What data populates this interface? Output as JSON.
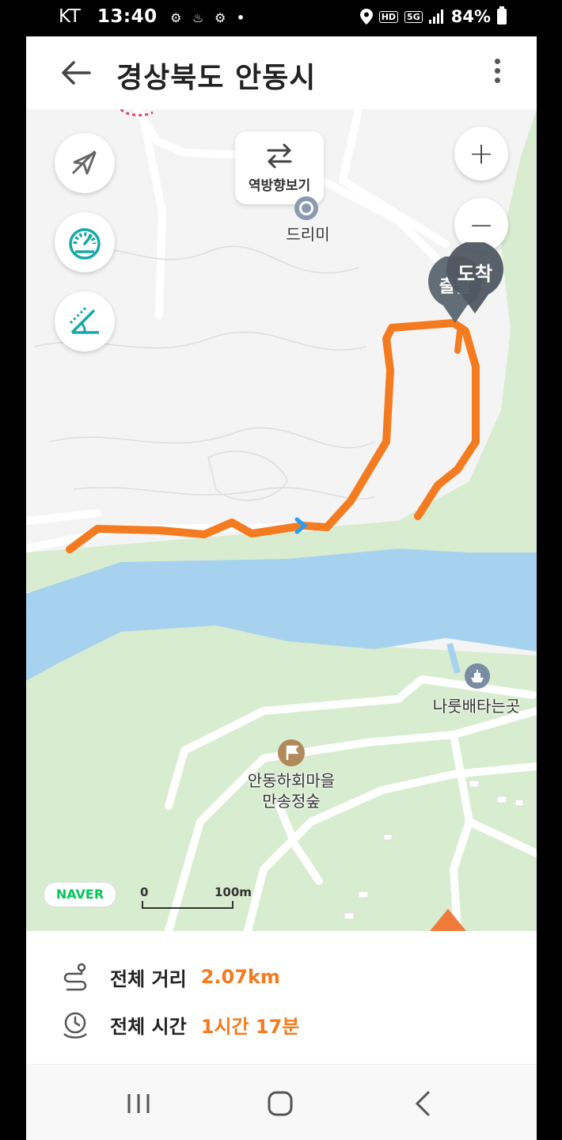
{
  "status_bar": {
    "carrier": "KT",
    "time": "13:40",
    "notification_icons": "⚙ ♨ ⚙ •",
    "hd_badge": "HD",
    "network": "5G",
    "battery": "84%"
  },
  "header": {
    "title": "경상북도 안동시"
  },
  "map": {
    "reverse_button_label": "역방향보기",
    "zoom_in": "+",
    "zoom_out": "−",
    "arrival_pin": "도착",
    "start_pin": "출발",
    "poi": {
      "dreami": "드리미",
      "ferry": "나룻배타는곳",
      "forest_line1": "안동하회마을",
      "forest_line2": "만송정숲"
    },
    "naver_logo": "NAVER",
    "scale": {
      "zero": "0",
      "max": "100m"
    },
    "route_color": "#f57b20",
    "river_color": "#a6d2f0",
    "park_color": "#d8ecd0"
  },
  "summary": {
    "distance_label": "전체 거리",
    "distance_value": "2.07km",
    "time_label": "전체 시간",
    "time_value": "1시간 17분"
  }
}
